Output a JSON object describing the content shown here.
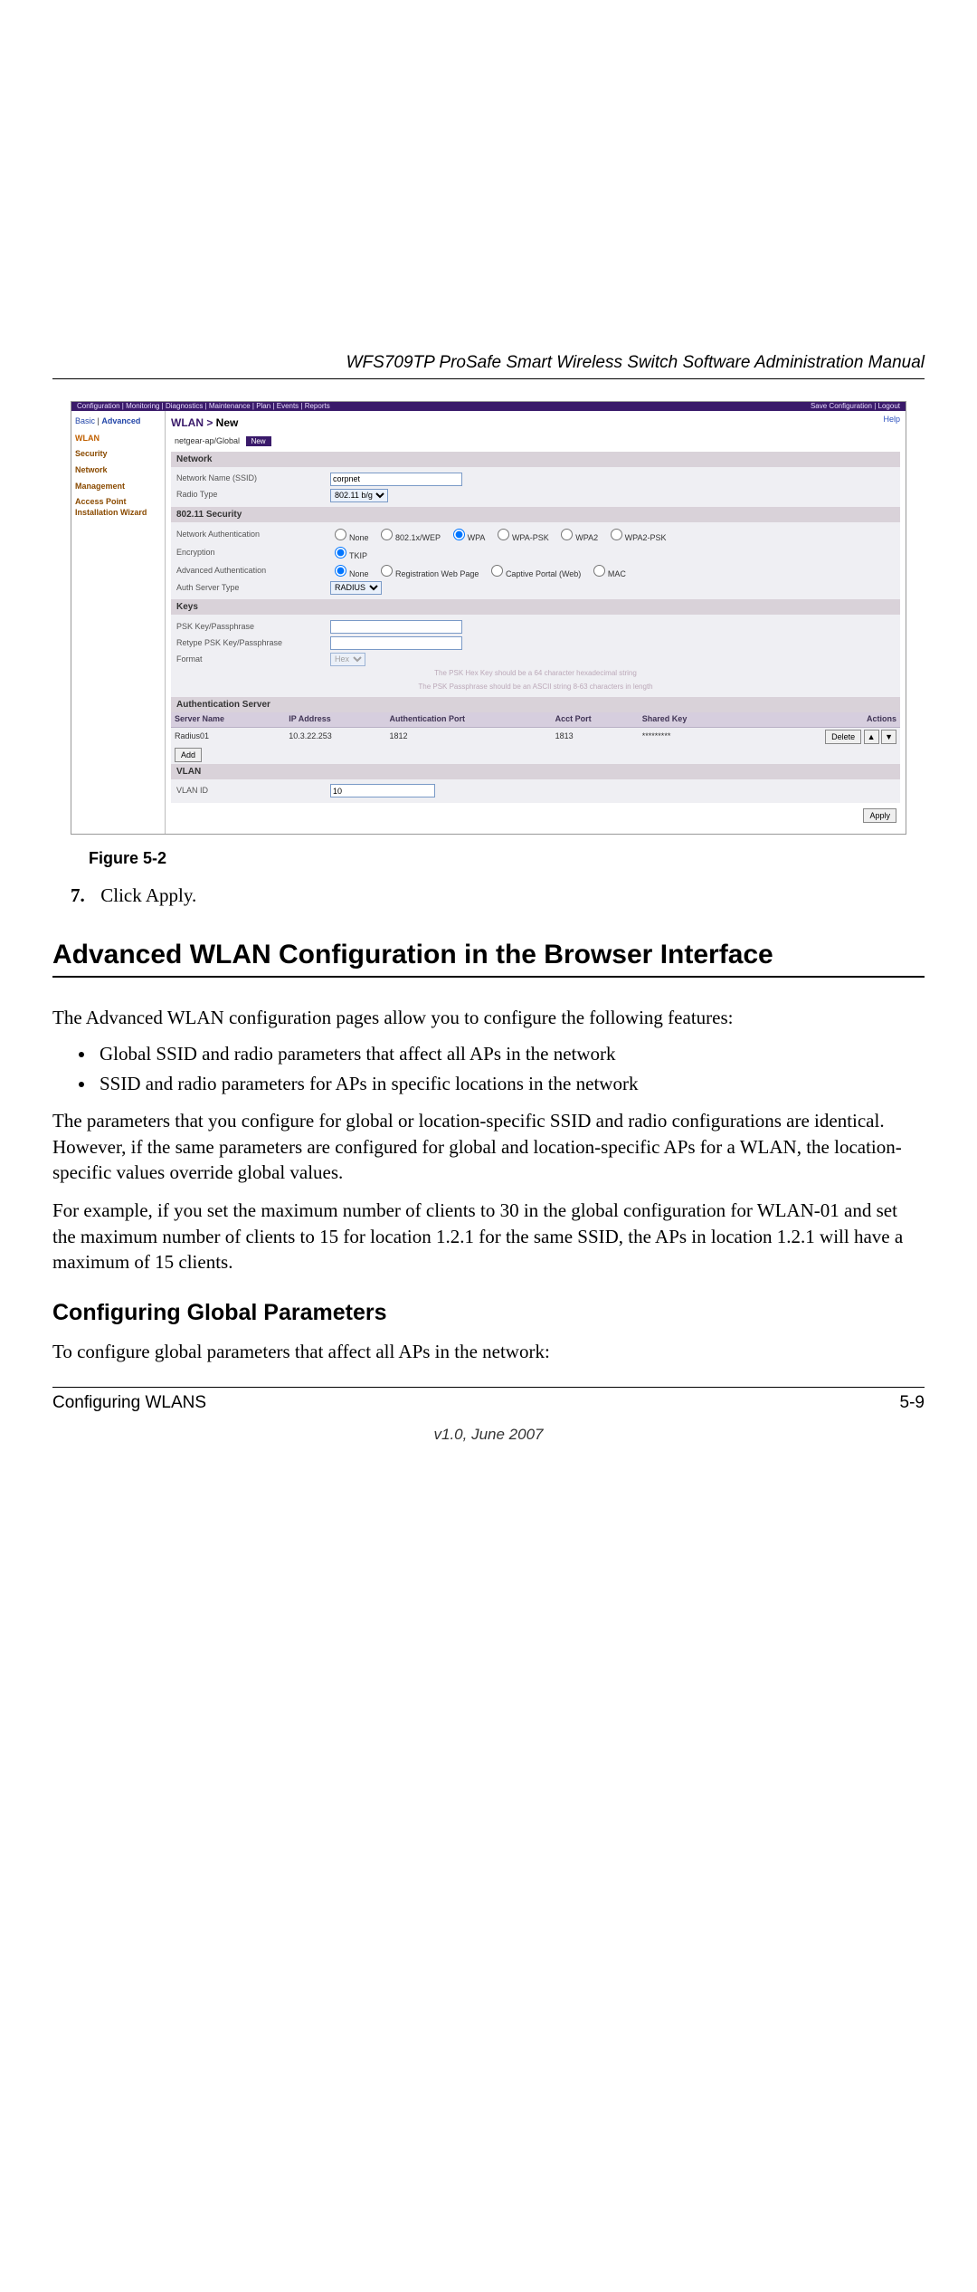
{
  "doc": {
    "header": "WFS709TP ProSafe Smart Wireless Switch Software Administration Manual",
    "figure_label": "Figure 5-2",
    "step_num": "7.",
    "step_text": "Click Apply.",
    "h1": "Advanced WLAN Configuration in the Browser Interface",
    "p1": "The Advanced WLAN configuration pages allow you to configure the following features:",
    "bullets": {
      "0": "Global SSID and radio parameters that affect all APs in the network",
      "1": "SSID and radio parameters for APs in specific locations in the network"
    },
    "p2": "The parameters that you configure for global or location-specific SSID and radio configurations are identical. However, if the same parameters are configured for global and location-specific APs for a WLAN, the location-specific values override global values.",
    "p3": "For example, if you set the maximum number of clients to 30 in the global configuration for WLAN-01 and set the maximum number of clients to 15 for location 1.2.1 for the same SSID, the APs in location 1.2.1 will have a maximum of 15 clients.",
    "h2": "Configuring Global Parameters",
    "p4": "To configure global parameters that affect all APs in the network:",
    "footer_left": "Configuring WLANS",
    "footer_right": "5-9",
    "version": "v1.0, June 2007"
  },
  "ui": {
    "topbar": {
      "left": "Configuration  |  Monitoring  |  Diagnostics  |  Maintenance  |  Plan  |  Events  |  Reports",
      "right": "Save Configuration  |  Logout"
    },
    "side": {
      "crumb_basic": "Basic",
      "crumb_sep": "|",
      "crumb_adv": "Advanced",
      "items": {
        "0": "WLAN",
        "1": "Security",
        "2": "Network",
        "3": "Management",
        "4": "Access Point Installation Wizard"
      }
    },
    "breadcrumb_root": "WLAN > ",
    "breadcrumb_leaf": "New",
    "help": "Help",
    "path": "netgear-ap/Global",
    "path_badge": "New",
    "network": {
      "head": "Network",
      "ssid_label": "Network Name (SSID)",
      "ssid_value": "corpnet",
      "radio_label": "Radio Type",
      "radio_value": "802.11 b/g"
    },
    "security": {
      "head": "802.11 Security",
      "netauth_label": "Network Authentication",
      "opts": {
        "none": "None",
        "wep": "802.1x/WEP",
        "wpa": "WPA",
        "wpapsk": "WPA-PSK",
        "wpa2": "WPA2",
        "wpa2psk": "WPA2-PSK"
      },
      "enc_label": "Encryption",
      "enc_value": "TKIP",
      "advauth_label": "Advanced Authentication",
      "advopts": {
        "none": "None",
        "reg": "Registration Web Page",
        "cap": "Captive Portal (Web)",
        "mac": "MAC"
      },
      "authserver_label": "Auth Server Type",
      "authserver_value": "RADIUS"
    },
    "keys": {
      "head": "Keys",
      "psk_label": "PSK Key/Passphrase",
      "retype_label": "Retype PSK Key/Passphrase",
      "format_label": "Format",
      "format_value": "Hex",
      "hint1": "The PSK Hex Key should be a 64 character hexadecimal string",
      "hint2": "The PSK Passphrase should be an ASCII string 8-63 characters in length"
    },
    "auth": {
      "head": "Authentication Server",
      "cols": {
        "name": "Server Name",
        "ip": "IP Address",
        "authport": "Authentication Port",
        "acctport": "Acct Port",
        "shared": "Shared Key",
        "actions": "Actions"
      },
      "row": {
        "name": "Radius01",
        "ip": "10.3.22.253",
        "authport": "1812",
        "acctport": "1813",
        "shared": "*********"
      },
      "delete": "Delete",
      "up": "▲",
      "down": "▼",
      "add": "Add"
    },
    "vlan": {
      "head": "VLAN",
      "label": "VLAN ID",
      "value": "10"
    },
    "apply": "Apply"
  }
}
